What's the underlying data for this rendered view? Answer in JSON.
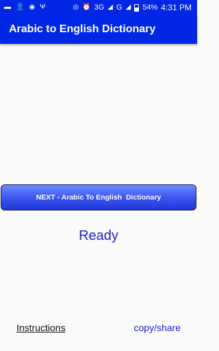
{
  "status_bar": {
    "left_icons": [
      "message-icon",
      "person-add-icon",
      "hd-icon",
      "usb-icon"
    ],
    "right_icons": [
      "hotspot-icon",
      "alarm-icon",
      "signal-3g-icon",
      "signal-g-icon",
      "battery-icon"
    ],
    "network_3g": "3G",
    "network_g": "G",
    "battery": "54%",
    "time": "4:31 PM"
  },
  "app_bar": {
    "title": "Arabic to English Dictionary"
  },
  "main": {
    "next_button_label": "NEXT - Arabic To English  Dictionary",
    "status_text": "Ready"
  },
  "footer": {
    "instructions_label": "Instructions",
    "copy_share_label": "copy/share"
  },
  "colors": {
    "primary": "#0026e6",
    "accent_text": "#1e22c8",
    "background": "#fafafa"
  }
}
